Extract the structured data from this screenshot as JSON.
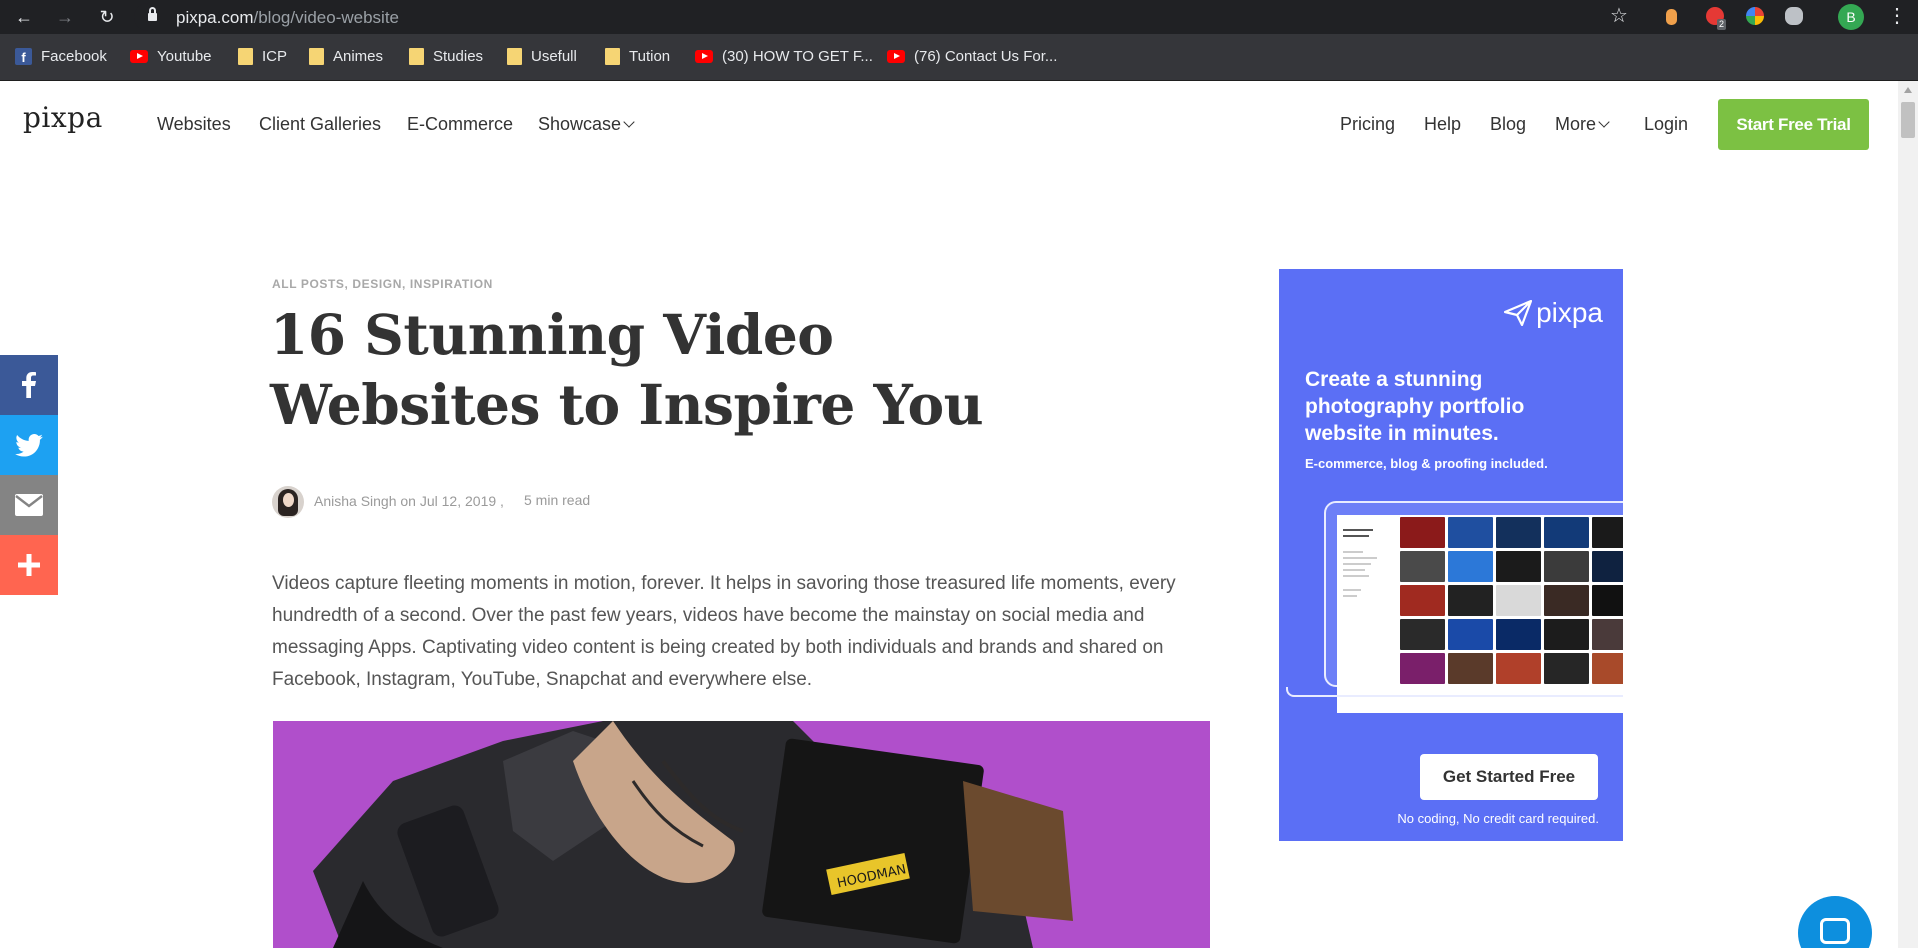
{
  "browser": {
    "url_host": "pixpa.com",
    "url_path": "/blog/video-website",
    "extension_badge": "2",
    "profile_initial": "B",
    "bookmarks": [
      {
        "label": "Facebook",
        "icon": "facebook-icon"
      },
      {
        "label": "Youtube",
        "icon": "youtube-icon"
      },
      {
        "label": "ICP",
        "icon": "folder-icon"
      },
      {
        "label": "Animes",
        "icon": "folder-icon"
      },
      {
        "label": "Studies",
        "icon": "folder-icon"
      },
      {
        "label": "Usefull",
        "icon": "folder-icon"
      },
      {
        "label": "Tution",
        "icon": "folder-icon"
      },
      {
        "label": "(30) HOW TO GET F...",
        "icon": "youtube-icon"
      },
      {
        "label": "(76) Contact Us For...",
        "icon": "youtube-icon"
      }
    ]
  },
  "site": {
    "logo": "pixpa",
    "nav_left": [
      "Websites",
      "Client Galleries",
      "E-Commerce",
      "Showcase"
    ],
    "nav_right": [
      "Pricing",
      "Help",
      "Blog",
      "More",
      "Login"
    ],
    "cta": "Start Free Trial",
    "accent_color": "#7cc143"
  },
  "share": [
    "facebook-icon",
    "twitter-icon",
    "mail-icon",
    "plus-icon"
  ],
  "article": {
    "categories": "ALL POSTS, DESIGN,  INSPIRATION",
    "title": "16 Stunning Video Websites to Inspire You",
    "author_line": "Anisha Singh on Jul 12, 2019 ,",
    "read_time": "5 min read",
    "intro": "Videos capture fleeting moments in motion, forever. It helps in savoring those treasured life moments, every hundredth of a second. Over the past few years, videos have become the mainstay on social media and messaging Apps. Captivating video content is being created by both individuals and brands and shared on Facebook, Instagram, YouTube, Snapchat and everywhere else."
  },
  "ad": {
    "logo": "pixpa",
    "headline": "Create a stunning photography portfolio website in minutes.",
    "subline": "E-commerce, blog & proofing included.",
    "button": "Get Started Free",
    "footnote": "No coding, No credit card required.",
    "bg_color": "#5b6ff5"
  }
}
